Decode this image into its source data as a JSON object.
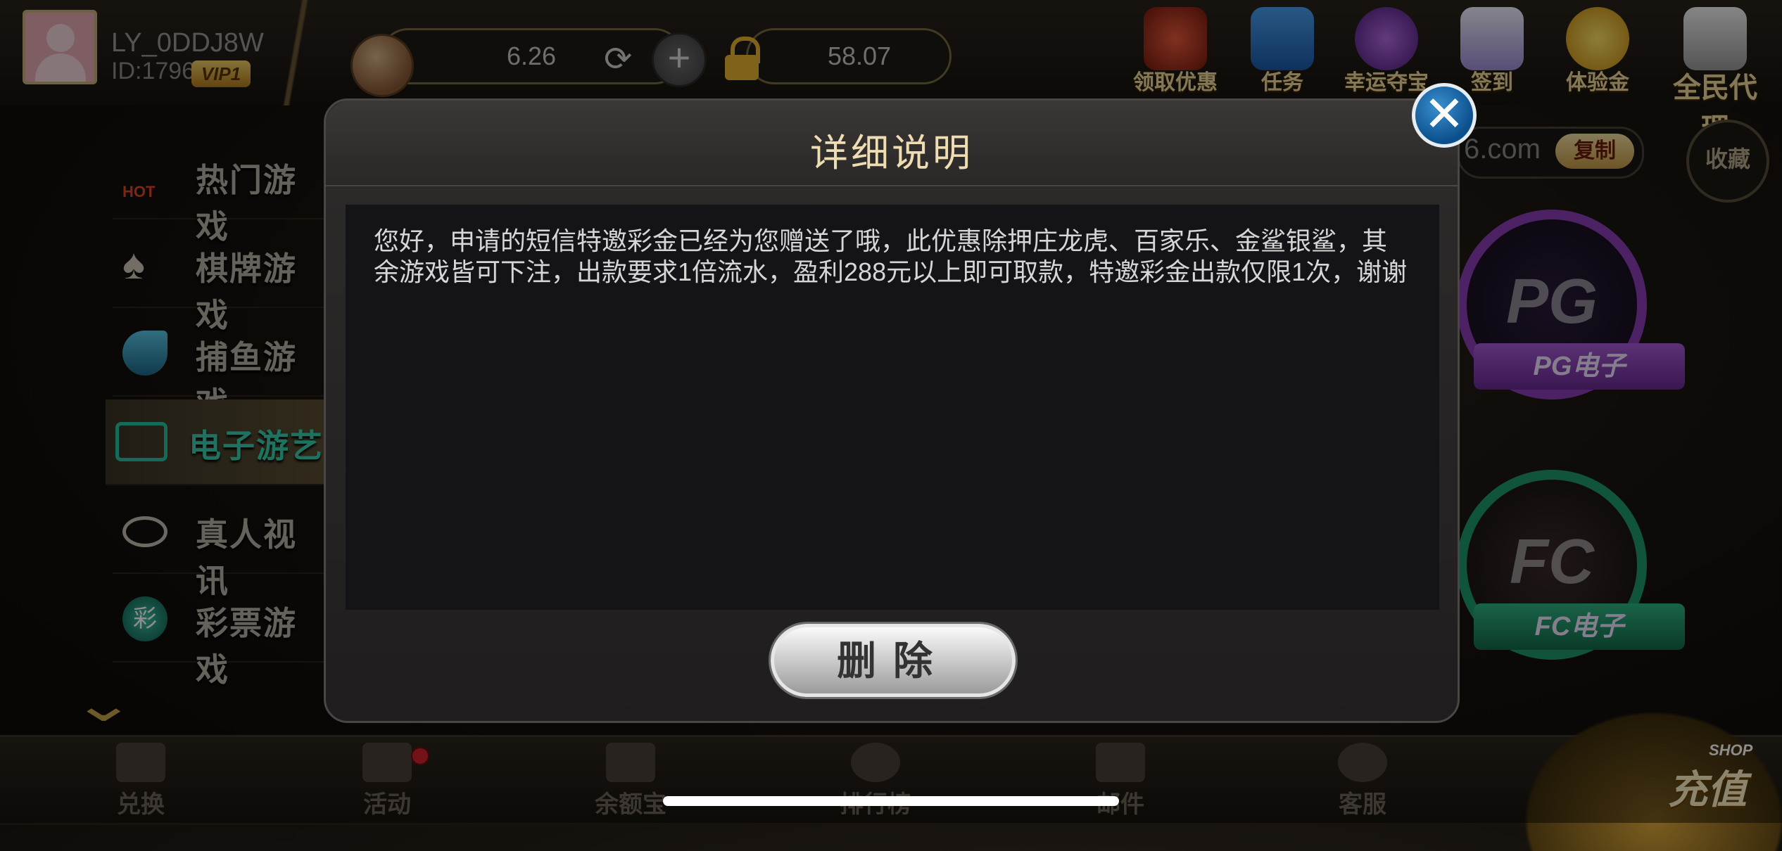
{
  "user": {
    "name": "LY_0DDJ8W",
    "id": "ID:1796",
    "vip": "VIP1"
  },
  "balances": {
    "coins": "6.26",
    "locked": "58.07"
  },
  "top_icons": [
    {
      "label": "领取优惠",
      "icon": "gift-bag-icon",
      "color": "#c0392b"
    },
    {
      "label": "任务",
      "icon": "gift-box-icon",
      "color": "#2a7bd6"
    },
    {
      "label": "幸运夺宝",
      "icon": "wheel-icon",
      "color": "#7b3fc2"
    },
    {
      "label": "签到",
      "icon": "checkin-icon",
      "color": "#8e7bd6"
    },
    {
      "label": "体验金",
      "icon": "yen-coin-icon",
      "color": "#e2b11f"
    },
    {
      "label": "全民代理",
      "icon": "megaphone-icon",
      "color": "#cfcfcf"
    }
  ],
  "sidebar": {
    "items": [
      {
        "label": "热门游戏",
        "badge": "HOT"
      },
      {
        "label": "棋牌游戏"
      },
      {
        "label": "捕鱼游戏"
      },
      {
        "label": "电子游艺"
      },
      {
        "label": "真人视讯"
      },
      {
        "label": "彩票游戏"
      }
    ]
  },
  "right": {
    "url_suffix": "6.com",
    "copy_label": "复制",
    "fav_label": "收藏",
    "games": [
      {
        "logo": "PG",
        "label": "PG电子",
        "color": "#8a3fb8"
      },
      {
        "logo": "FC",
        "label": "FC电子",
        "color": "#1f9a6e"
      }
    ]
  },
  "bottom_nav": [
    {
      "label": "兑换"
    },
    {
      "label": "活动"
    },
    {
      "label": "余额宝"
    },
    {
      "label": "排行榜"
    },
    {
      "label": "邮件"
    },
    {
      "label": "客服"
    }
  ],
  "shop": {
    "badge": "SHOP",
    "label": "充值"
  },
  "modal": {
    "title": "详细说明",
    "body": "您好，申请的短信特邀彩金已经为您赠送了哦，此优惠除押庄龙虎、百家乐、金鲨银鲨，其余游戏皆可下注，出款要求1倍流水，盈利288元以上即可取款，特邀彩金出款仅限1次，谢谢",
    "delete_label": "删除",
    "close_symbol": "✕"
  }
}
